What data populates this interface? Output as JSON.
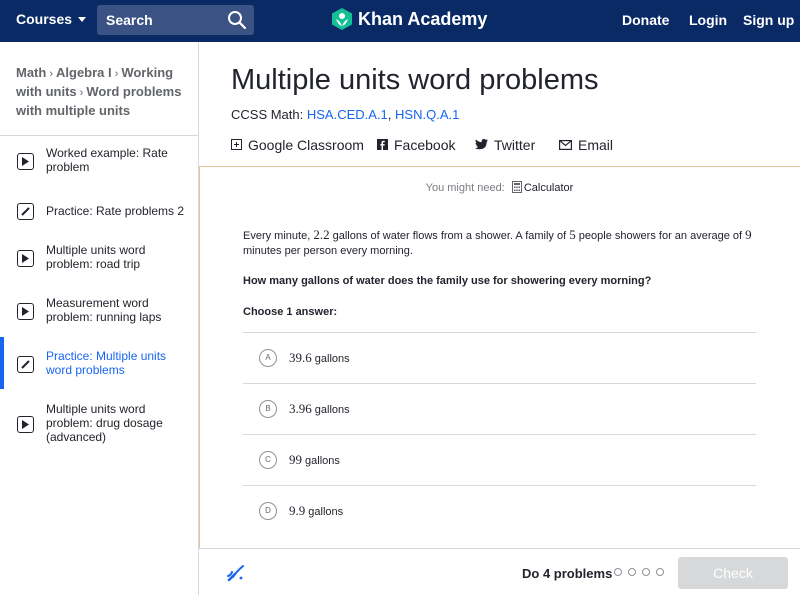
{
  "header": {
    "courses": "Courses",
    "search_placeholder": "Search",
    "logo": "Khan Academy",
    "donate": "Donate",
    "login": "Login",
    "signup": "Sign up"
  },
  "breadcrumb": [
    "Math",
    "Algebra I",
    "Working with units",
    "Word problems with multiple units"
  ],
  "sidebar": {
    "items": [
      {
        "label": "Worked example: Rate problem",
        "type": "video"
      },
      {
        "label": "Practice: Rate problems 2",
        "type": "exercise"
      },
      {
        "label": "Multiple units word problem: road trip",
        "type": "video"
      },
      {
        "label": "Measurement word problem: running laps",
        "type": "video"
      },
      {
        "label": "Practice: Multiple units word problems",
        "type": "exercise",
        "active": true
      },
      {
        "label": "Multiple units word problem: drug dosage (advanced)",
        "type": "video"
      }
    ]
  },
  "main": {
    "title": "Multiple units word problems",
    "ccss_label": "CCSS Math:",
    "ccss_link1": "HSA.CED.A.1",
    "ccss_link2": "HSN.Q.A.1",
    "share": {
      "classroom": "Google Classroom",
      "facebook": "Facebook",
      "twitter": "Twitter",
      "email": "Email"
    }
  },
  "exercise": {
    "need_prefix": "You might need:",
    "need_tool": "Calculator",
    "q_part1": "Every minute, ",
    "q_num1": "2.2",
    "q_part2": " gallons of water flows from a shower. A family of ",
    "q_num2": "5",
    "q_part3": " people showers for an average of ",
    "q_num3": "9",
    "q_part4": " minutes per person every morning.",
    "question": "How many gallons of water does the family use for showering every morning?",
    "choose": "Choose 1 answer:",
    "choices": [
      {
        "letter": "A",
        "value": "39.6",
        "unit": " gallons"
      },
      {
        "letter": "B",
        "value": "3.96",
        "unit": " gallons"
      },
      {
        "letter": "C",
        "value": "99",
        "unit": " gallons"
      },
      {
        "letter": "D",
        "value": "9.9",
        "unit": " gallons"
      }
    ]
  },
  "footer": {
    "progress": "Do 4 problems",
    "check": "Check"
  }
}
